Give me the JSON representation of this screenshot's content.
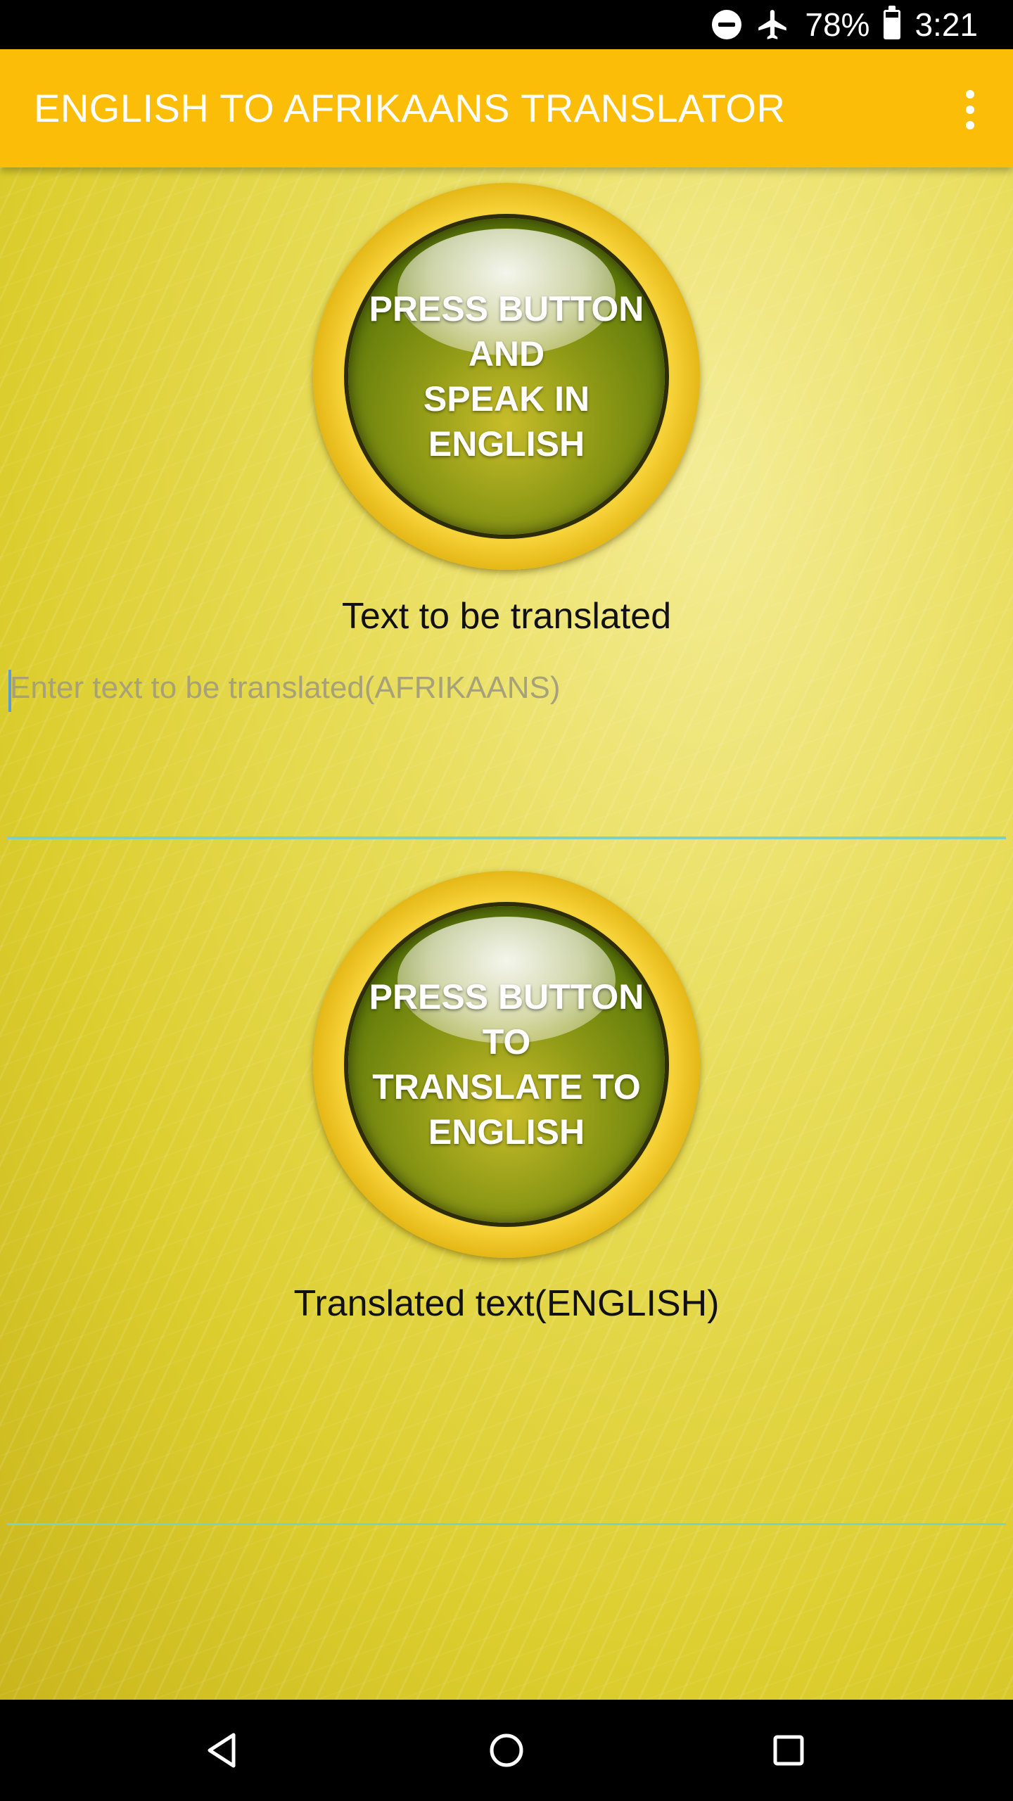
{
  "status_bar": {
    "battery": "78%",
    "time": "3:21",
    "icons": [
      "do-not-disturb-icon",
      "airplane-mode-icon",
      "battery-icon"
    ]
  },
  "app_bar": {
    "title": "ENGLISH TO AFRIKAANS TRANSLATOR",
    "menu_icon": "overflow-menu-icon"
  },
  "speak_button": {
    "label": "PRESS BUTTON AND\nSPEAK IN ENGLISH"
  },
  "input_section": {
    "caption": "Text to be translated",
    "placeholder": "Enter text to be translated(AFRIKAANS)",
    "value": ""
  },
  "translate_button": {
    "label": "PRESS BUTTON TO\nTRANSLATE TO\nENGLISH"
  },
  "output_section": {
    "caption": "Translated text(ENGLISH)"
  },
  "nav_bar": {
    "buttons": [
      "back-icon",
      "home-icon",
      "recents-icon"
    ]
  },
  "colors": {
    "app_bar": "#fbbd07",
    "background": "#e8dd5a",
    "underline": "#7fcfc2",
    "button_face": "#6b8a0e",
    "button_ring": "#e2b412"
  }
}
